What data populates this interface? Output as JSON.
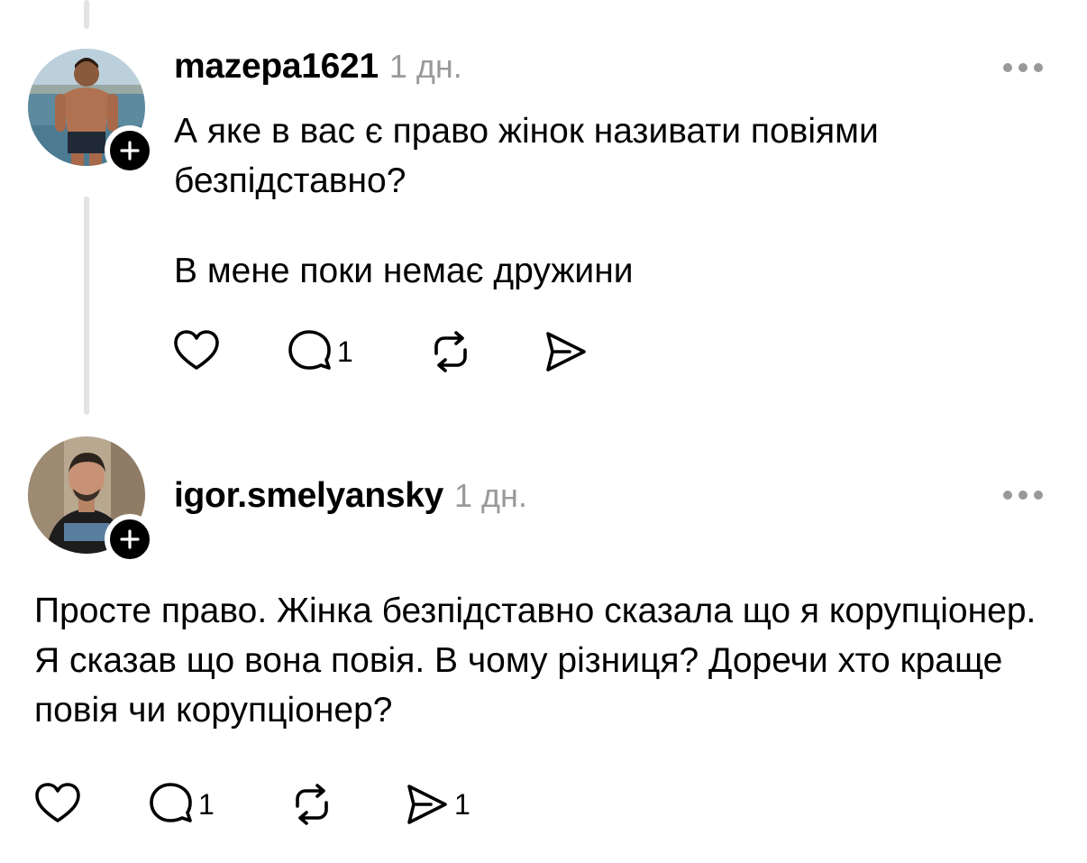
{
  "posts": [
    {
      "username": "mazepa1621",
      "time": "1 дн.",
      "paragraphs": [
        "А яке в вас є право жінок називати повіями безпідставно?",
        "В мене поки немає дружини"
      ],
      "actions": {
        "like_count": "",
        "reply_count": "1",
        "repost_count": "",
        "share_count": ""
      }
    },
    {
      "username": "igor.smelyansky",
      "time": "1 дн.",
      "paragraphs": [
        "Просте право. Жінка безпідставно сказала що я корупціонер. Я сказав що вона повія. В чому різниця? Доречи хто краще повія чи корупціонер?"
      ],
      "actions": {
        "like_count": "",
        "reply_count": "1",
        "repost_count": "",
        "share_count": "1"
      }
    }
  ],
  "icons": {
    "like": "heart-icon",
    "reply": "comment-icon",
    "repost": "repost-icon",
    "share": "send-icon",
    "more": "more-horizontal-icon",
    "follow": "plus-icon"
  },
  "colors": {
    "text": "#000000",
    "muted": "#9a9a9a",
    "thread_line": "#e3e3e3",
    "background": "#ffffff"
  }
}
